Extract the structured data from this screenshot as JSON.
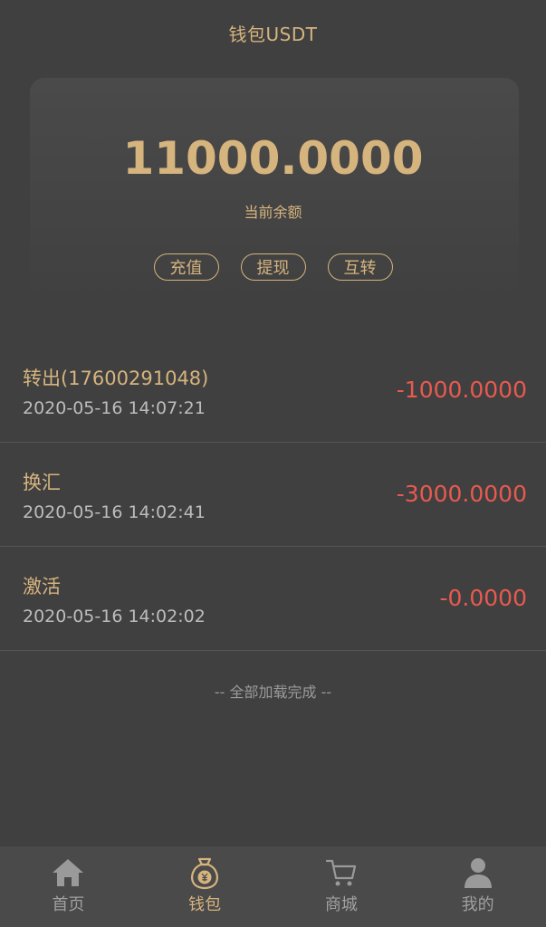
{
  "header": {
    "title": "钱包USDT"
  },
  "balance": {
    "amount": "11000.0000",
    "label": "当前余额"
  },
  "actions": [
    {
      "label": "充值"
    },
    {
      "label": "提现"
    },
    {
      "label": "互转"
    }
  ],
  "transactions": [
    {
      "title": "转出(17600291048)",
      "time": "2020-05-16 14:07:21",
      "amount": "-1000.0000"
    },
    {
      "title": "换汇",
      "time": "2020-05-16 14:02:41",
      "amount": "-3000.0000"
    },
    {
      "title": "激活",
      "time": "2020-05-16 14:02:02",
      "amount": "-0.0000"
    }
  ],
  "list_end_text": "-- 全部加载完成 --",
  "tabbar": {
    "items": [
      {
        "label": "首页",
        "icon": "home-icon",
        "active": false
      },
      {
        "label": "钱包",
        "icon": "wallet-icon",
        "active": true
      },
      {
        "label": "商城",
        "icon": "cart-icon",
        "active": false
      },
      {
        "label": "我的",
        "icon": "user-icon",
        "active": false
      }
    ]
  },
  "colors": {
    "background": "#404040",
    "accent_gold": "#d6b47e",
    "negative_amount": "#e85a4f",
    "tabbar_bg": "#4a4a4a"
  }
}
